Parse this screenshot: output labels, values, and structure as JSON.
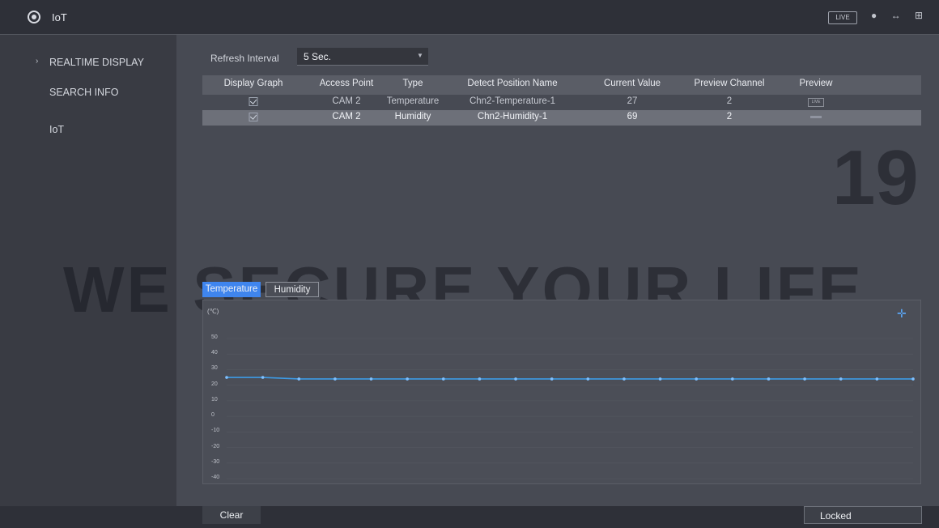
{
  "header": {
    "app_title": "IoT",
    "live_badge": "LIVE",
    "icons": [
      "globe-icon",
      "user-icon",
      "network-icon",
      "grid-icon"
    ]
  },
  "sidebar": {
    "items": [
      {
        "label": "REALTIME DISPLAY",
        "active": true
      },
      {
        "label": "SEARCH INFO"
      },
      {
        "label": "IoT"
      }
    ]
  },
  "refresh": {
    "label": "Refresh Interval",
    "value": "5 Sec."
  },
  "table": {
    "columns": [
      "Display Graph",
      "Access Point",
      "Type",
      "Detect Position Name",
      "Current Value",
      "Preview Channel",
      "Preview"
    ],
    "rows": [
      {
        "display_graph": true,
        "access_point": "CAM 2",
        "type": "Temperature",
        "position": "Chn2-Temperature-1",
        "value": "27",
        "channel": "2",
        "preview": "LIVE"
      },
      {
        "display_graph": true,
        "access_point": "CAM 2",
        "type": "Humidity",
        "position": "Chn2-Humidity-1",
        "value": "69",
        "channel": "2",
        "preview": ""
      }
    ]
  },
  "chart_tabs": {
    "active": "Temperature",
    "inactive": "Humidity"
  },
  "chart_data": {
    "type": "line",
    "unit_label": "(℃)",
    "yticks": [
      "50",
      "40",
      "30",
      "20",
      "10",
      "0",
      "-10",
      "-20",
      "-30",
      "-40"
    ],
    "ylim": [
      -40,
      50
    ],
    "series": [
      {
        "values": [
          25,
          25,
          24,
          24,
          24,
          24,
          24,
          24,
          24,
          24,
          24,
          24,
          24,
          24,
          24,
          24,
          24,
          24,
          24,
          24
        ]
      }
    ],
    "line_color": "#3d9be6"
  },
  "watermark": {
    "text": "WE SECURE YOUR LIFE",
    "year": "19"
  },
  "footer": {
    "clear_label": "Clear",
    "locked_label": "Locked"
  }
}
